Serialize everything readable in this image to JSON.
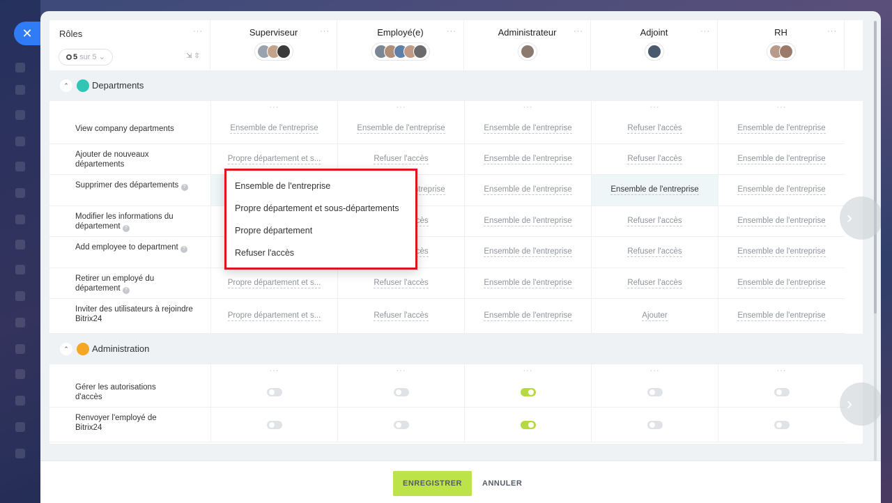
{
  "header": {
    "roles_title": "Rôles",
    "filter": {
      "count": "5",
      "suffix": "sur 5"
    },
    "roles": [
      {
        "name": "Superviseur",
        "avatar_colors": [
          "#9aa3ad",
          "#c2a38a",
          "#3a3a3a"
        ]
      },
      {
        "name": "Employé(e)",
        "avatar_colors": [
          "#7b8794",
          "#b08f78",
          "#5e7fa8",
          "#c09a84",
          "#6b6b6b"
        ]
      },
      {
        "name": "Administrateur",
        "avatar_colors": [
          "#8c7a6e"
        ]
      },
      {
        "name": "Adjoint",
        "avatar_colors": [
          "#4a5a6e"
        ]
      },
      {
        "name": "RH",
        "avatar_colors": [
          "#b89a8a",
          "#9c7a6a"
        ]
      }
    ]
  },
  "sections": {
    "departments": {
      "title": "Departments",
      "icon_color": "#2fc6b6",
      "rows": [
        {
          "label": "View company departments",
          "help": false,
          "values": [
            "Ensemble de l'entreprise",
            "Ensemble de l'entreprise",
            "Ensemble de l'entreprise",
            "Refuser l'accès",
            "Ensemble de l'entreprise"
          ]
        },
        {
          "label": "Ajouter de nouveaux départements",
          "help": false,
          "values": [
            "Propre département et s...",
            "Refuser l'accès",
            "Ensemble de l'entreprise",
            "Refuser l'accès",
            "Ensemble de l'entreprise"
          ]
        },
        {
          "label": "Supprimer des départements",
          "help": true,
          "values": [
            "",
            "Ensemble de l'entreprise",
            "Ensemble de l'entreprise",
            "Ensemble de l'entreprise",
            "Ensemble de l'entreprise"
          ]
        },
        {
          "label": "Modifier les informations du département",
          "help": true,
          "values": [
            "",
            "Refuser l'accès",
            "Ensemble de l'entreprise",
            "Refuser l'accès",
            "Ensemble de l'entreprise"
          ]
        },
        {
          "label": "Add employee to department",
          "help": true,
          "values": [
            "",
            "Refuser l'accès",
            "Ensemble de l'entreprise",
            "Refuser l'accès",
            "Ensemble de l'entreprise"
          ]
        },
        {
          "label": "Retirer un employé du département",
          "help": true,
          "values": [
            "Propre département et s...",
            "Refuser l'accès",
            "Ensemble de l'entreprise",
            "Refuser l'accès",
            "Ensemble de l'entreprise"
          ]
        },
        {
          "label": "Inviter des utilisateurs à rejoindre Bitrix24",
          "help": false,
          "values": [
            "Propre département et s...",
            "Refuser l'accès",
            "Ensemble de l'entreprise",
            "Ajouter",
            "Ensemble de l'entreprise"
          ]
        }
      ]
    },
    "administration": {
      "title": "Administration",
      "icon_color": "#f5a623",
      "rows": [
        {
          "label": "Gérer les autorisations d'accès",
          "toggles": [
            false,
            false,
            true,
            false,
            false
          ]
        },
        {
          "label": "Renvoyer l'employé de Bitrix24",
          "toggles": [
            false,
            false,
            true,
            false,
            false
          ]
        }
      ]
    }
  },
  "dropdown": {
    "options": [
      "Ensemble de l'entreprise",
      "Propre département et sous-départements",
      "Propre département",
      "Refuser l'accès"
    ]
  },
  "footer": {
    "save_label": "ENREGISTRER",
    "cancel_label": "ANNULER"
  },
  "icons": {
    "close": "close-icon",
    "more": "more-dots-icon",
    "chevron_right": "chevron-right-icon"
  },
  "colors": {
    "accent": "#2f7cf6",
    "save": "#bde34a",
    "highlight_border": "#e0141e"
  }
}
